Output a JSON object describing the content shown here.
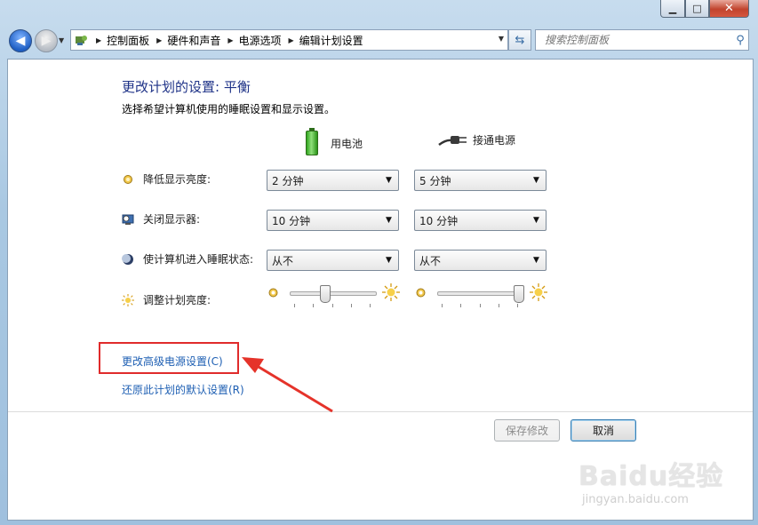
{
  "window": {
    "minimize": "▁",
    "maximize": "□",
    "close": "✕"
  },
  "nav": {
    "back_icon": "arrow-left-icon",
    "forward_icon": "arrow-right-icon",
    "breadcrumbs": [
      "控制面板",
      "硬件和声音",
      "电源选项",
      "编辑计划设置"
    ],
    "search_placeholder": "搜索控制面板"
  },
  "main": {
    "title": "更改计划的设置: 平衡",
    "subtitle": "选择希望计算机使用的睡眠设置和显示设置。",
    "columns": {
      "battery": "用电池",
      "plugged": "接通电源"
    },
    "rows": [
      {
        "label": "降低显示亮度:",
        "battery": "2 分钟",
        "plugged": "5 分钟",
        "icon": "dim-sun-icon"
      },
      {
        "label": "关闭显示器:",
        "battery": "10 分钟",
        "plugged": "10 分钟",
        "icon": "monitor-clock-icon"
      },
      {
        "label": "使计算机进入睡眠状态:",
        "battery": "从不",
        "plugged": "从不",
        "icon": "moon-icon"
      }
    ],
    "brightness": {
      "label": "调整计划亮度:",
      "battery_level": 0.4,
      "plugged_level": 1.0
    },
    "links": {
      "advanced": "更改高级电源设置(C)",
      "restore": "还原此计划的默认设置(R)"
    },
    "buttons": {
      "save": "保存修改",
      "cancel": "取消"
    }
  },
  "colors": {
    "highlight_box": "#e02b2b",
    "link": "#1e5fb3",
    "title": "#1e3287"
  },
  "watermark": {
    "main": "Baidu经验",
    "sub": "jingyan.baidu.com"
  }
}
